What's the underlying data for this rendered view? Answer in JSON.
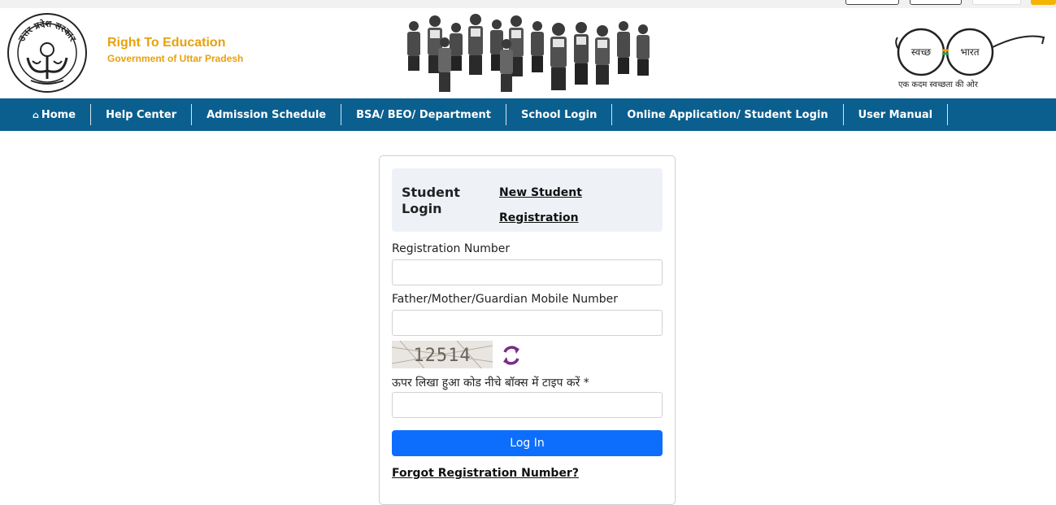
{
  "header": {
    "title": "Right To Education",
    "subtitle": "Government of Uttar Pradesh",
    "emblem_text": "उत्तर प्रदेश सरकार",
    "swachh_left": "स्वच्छ",
    "swachh_right": "भारत",
    "swachh_tagline": "एक कदम स्वच्छता की ओर"
  },
  "nav": {
    "items": [
      {
        "label": "Home",
        "icon": "home-icon"
      },
      {
        "label": "Help Center"
      },
      {
        "label": "Admission Schedule"
      },
      {
        "label": "BSA/ BEO/ Department"
      },
      {
        "label": "School Login"
      },
      {
        "label": "Online Application/ Student Login"
      },
      {
        "label": "User Manual"
      }
    ]
  },
  "login": {
    "title": "Student Login",
    "new_student_link": "New Student Registration",
    "registration_label": "Registration Number",
    "registration_value": "",
    "mobile_label": "Father/Mother/Guardian Mobile Number",
    "mobile_value": "",
    "captcha_code": "12514",
    "captcha_label": "ऊपर लिखा हुआ कोड नीचे बॉक्स में टाइप करें *",
    "captcha_value": "",
    "login_button": "Log In",
    "forgot_link": "Forgot Registration Number?"
  },
  "colors": {
    "nav_bg": "#0b5f8f",
    "brand": "#e8a10c",
    "button": "#0d6efd",
    "refresh_icon": "#7b2a8c"
  }
}
